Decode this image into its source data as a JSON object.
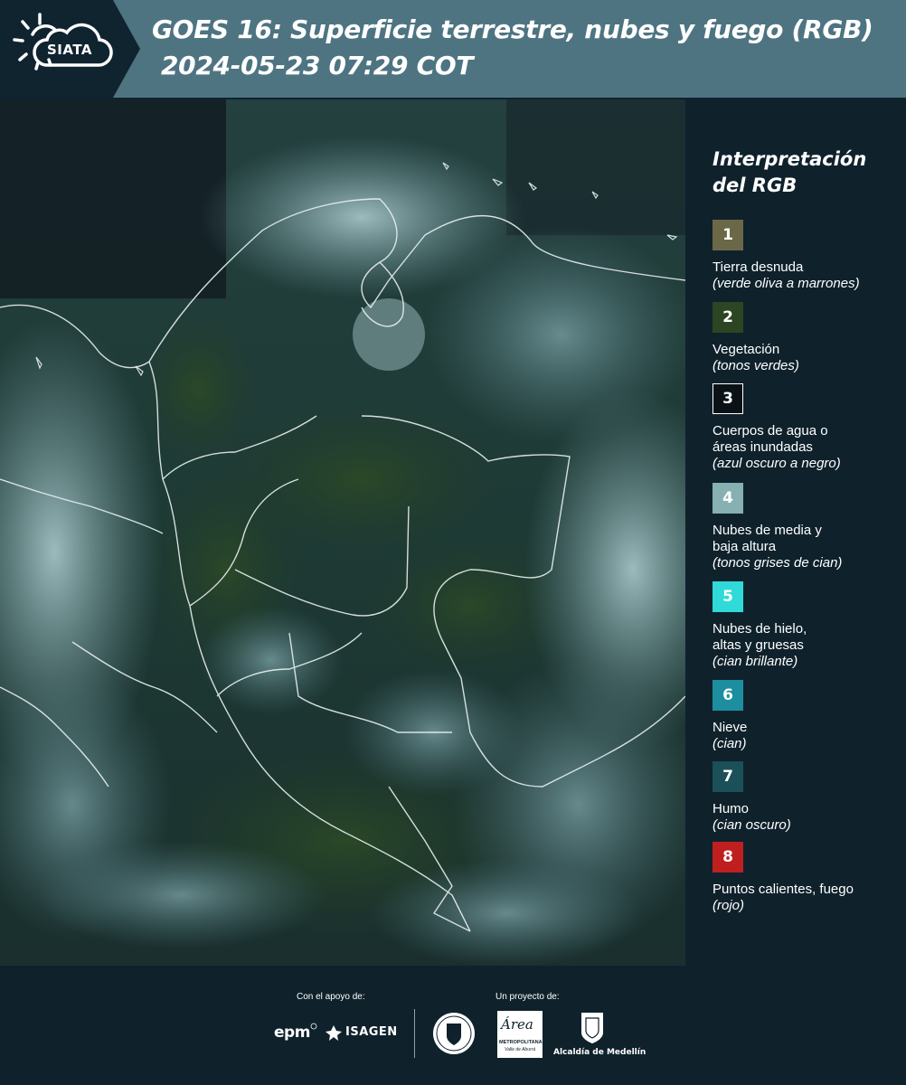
{
  "header": {
    "logo_text": "SIATA",
    "title_line1": "GOES 16: Superficie terrestre, nubes y fuego (RGB)",
    "title_line2": "2024-05-23 07:29 COT",
    "colors": {
      "bar": "#4e7482",
      "logo_block": "#102430"
    }
  },
  "legend": {
    "title": "Interpretación del RGB",
    "items": [
      {
        "number": "1",
        "label": "Tierra desnuda",
        "sub": "(verde oliva a marrones)",
        "color": "#6b6848"
      },
      {
        "number": "2",
        "label": "Vegetación",
        "sub": "(tonos verdes)",
        "color": "#2d4522"
      },
      {
        "number": "3",
        "label": "Cuerpos de agua o áreas inundadas",
        "sub": "(azul oscuro a negro)",
        "color": "#0a1218"
      },
      {
        "number": "4",
        "label": "Nubes de media y baja altura",
        "sub": "(tonos grises de cian)",
        "color": "#86b0b2"
      },
      {
        "number": "5",
        "label": "Nubes de hielo, altas y gruesas",
        "sub": "(cian brillante)",
        "color": "#2fdad8"
      },
      {
        "number": "6",
        "label": "Nieve",
        "sub": "(cian)",
        "color": "#1c8ea0"
      },
      {
        "number": "7",
        "label": "Humo",
        "sub": "(cian oscuro)",
        "color": "#1b5058"
      },
      {
        "number": "8",
        "label": "Puntos calientes, fuego",
        "sub": "(rojo)",
        "color": "#c01f1f"
      }
    ]
  },
  "footer": {
    "support_caption": "Con el apoyo de:",
    "project_caption": "Un proyecto de:",
    "logo_epm": "epm",
    "logo_isagen": "ISAGEN",
    "logo_area_title": "Área",
    "logo_area_sub": "METROPOLITANA",
    "logo_area_sub2": "Valle de Aburrá",
    "logo_alcaldia": "Alcaldía de Medellín"
  }
}
